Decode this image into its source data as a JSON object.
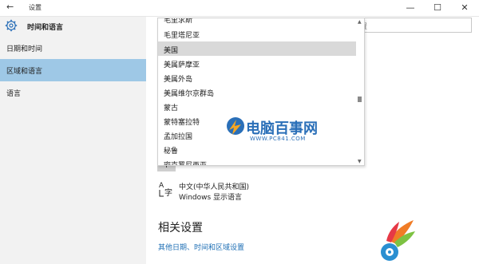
{
  "window": {
    "title": "设置",
    "back_glyph": "←",
    "minimize_glyph": "—",
    "maximize_glyph": "☐",
    "close_glyph": "✕"
  },
  "sidebar": {
    "header": "时间和语言",
    "items": [
      {
        "label": "日期和时间"
      },
      {
        "label": "区域和语言"
      },
      {
        "label": "语言"
      }
    ],
    "active_index": 1
  },
  "search": {
    "value": "置"
  },
  "dropdown": {
    "items": [
      {
        "label": "毛里求斯"
      },
      {
        "label": "毛里塔尼亚"
      },
      {
        "label": "美国"
      },
      {
        "label": "美属萨摩亚"
      },
      {
        "label": "美属外岛"
      },
      {
        "label": "美属维尔京群岛"
      },
      {
        "label": "蒙古"
      },
      {
        "label": "蒙特塞拉特"
      },
      {
        "label": "孟加拉国"
      },
      {
        "label": "秘鲁"
      },
      {
        "label": "密克罗尼西亚"
      }
    ],
    "selected_index": 2
  },
  "add_button": {
    "label": "+"
  },
  "language_entry": {
    "name": "中文(中华人民共和国)",
    "sublabel": "Windows 显示语言"
  },
  "related": {
    "title": "相关设置",
    "link": "其他日期、时间和区域设置"
  },
  "watermark": {
    "brand": "电脑百事网",
    "url": "WWW.PC841.COM"
  },
  "colors": {
    "sidebar_bg": "#f2f2f2",
    "active_item": "#9ec8e6",
    "selected_row": "#d9d9d9",
    "link": "#1e6fb5",
    "brand_blue": "#2a6fb8"
  }
}
